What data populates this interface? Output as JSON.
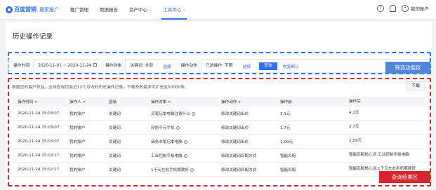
{
  "brand": {
    "name": "百度营销",
    "sub": "搜索推广"
  },
  "nav": {
    "items": [
      {
        "label": "推广管理",
        "caret": false
      },
      {
        "label": "数据报告",
        "caret": false
      },
      {
        "label": "资产中心",
        "caret": true
      },
      {
        "label": "工具中心",
        "caret": true
      }
    ],
    "account": "我的账户"
  },
  "page": {
    "title": "历史操作记录"
  },
  "filter": {
    "time_label": "操作时间",
    "time_value": "2020-11-01 ~ 2020-11-24",
    "object_label": "操作对象",
    "keyword_label": "关键词: 全部",
    "select1": "选择",
    "action_label": "操作动作",
    "selected_label": "已选操作: 不限",
    "select2": "选择",
    "query": "查询",
    "reset": "恢复默认"
  },
  "annotations": {
    "filter_area": "筛选功能区",
    "result_area": "查询结果区"
  },
  "results": {
    "notice": "根据您的客户权益，支持查询您最近12个月内的历史操作记录，下载条数最多可扩充至50000条。",
    "download": "下载",
    "columns": [
      "操作时间",
      "操作人",
      "层级",
      "操作对象",
      "操作动作",
      "操作前",
      "操作后"
    ],
    "rows": [
      {
        "time": "2020-11-24 15:03:07",
        "user": "我的账户",
        "level": "关键词",
        "object": "买笔记本电脑注意什么",
        "action": "修改关键词出价",
        "before": "3.1元",
        "after": "4.1元"
      },
      {
        "time": "2020-11-24 15:03:07",
        "user": "我的账户",
        "level": "关键词",
        "object": "好的千元手机",
        "action": "修改关键词出价",
        "before": "1.7元",
        "after": "2.7元"
      },
      {
        "time": "2020-11-24 15:03:07",
        "user": "我的账户",
        "level": "关键词",
        "object": "商务本笔记本电脑",
        "action": "修改关键词出价",
        "before": "1.09元",
        "after": "2.09元"
      },
      {
        "time": "2020-11-24 15:02:27",
        "user": "我的账户",
        "level": "关键词",
        "object": "工业控制平板电脑",
        "action": "修改关键词匹配方式",
        "before": "智能匹配",
        "after": "智能匹配核心词:工业控制平板电脑"
      },
      {
        "time": "2020-11-24 15:02:27",
        "user": "我的账户",
        "level": "关键词",
        "object": "1千元左右手机哪款好",
        "action": "修改关键词匹配方式",
        "before": "智能匹配",
        "after": "智能匹配核心词:1千元左右手机哪款好"
      }
    ]
  }
}
